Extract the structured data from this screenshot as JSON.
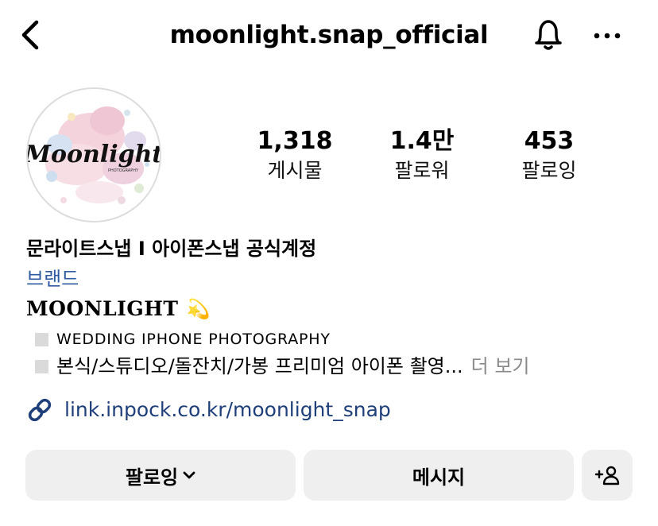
{
  "header": {
    "username": "moonlight.snap_official",
    "back_icon": "chevron-left-icon",
    "bell_icon": "bell-icon",
    "more_icon": "more-horizontal-icon"
  },
  "avatar": {
    "logo_text": "Moonlight",
    "logo_subtext": "PHOTOGRAPHY"
  },
  "stats": [
    {
      "value": "1,318",
      "label": "게시물"
    },
    {
      "value": "1.4만",
      "label": "팔로워"
    },
    {
      "value": "453",
      "label": "팔로잉"
    }
  ],
  "bio": {
    "name": "문라이트스냅 I 아이폰스냅 공식계정",
    "category": "브랜드",
    "brand": "MOONLIGHT",
    "brand_emoji": "💫",
    "lines": [
      "WEDDING IPHONE PHOTOGRAPHY",
      "본식/스튜디오/돌잔치/가봉 프리미엄 아이폰 촬영..."
    ],
    "more_label": "더 보기",
    "link": "link.inpock.co.kr/moonlight_snap",
    "link_icon": "link-icon"
  },
  "buttons": {
    "follow_label": "팔로잉",
    "message_label": "메시지",
    "add_person_icon": "add-person-icon"
  },
  "colors": {
    "link_blue": "#1f3f7a",
    "category_blue": "#2e5aa0",
    "button_bg": "#efefef",
    "more_gray": "#8a8a8a"
  }
}
